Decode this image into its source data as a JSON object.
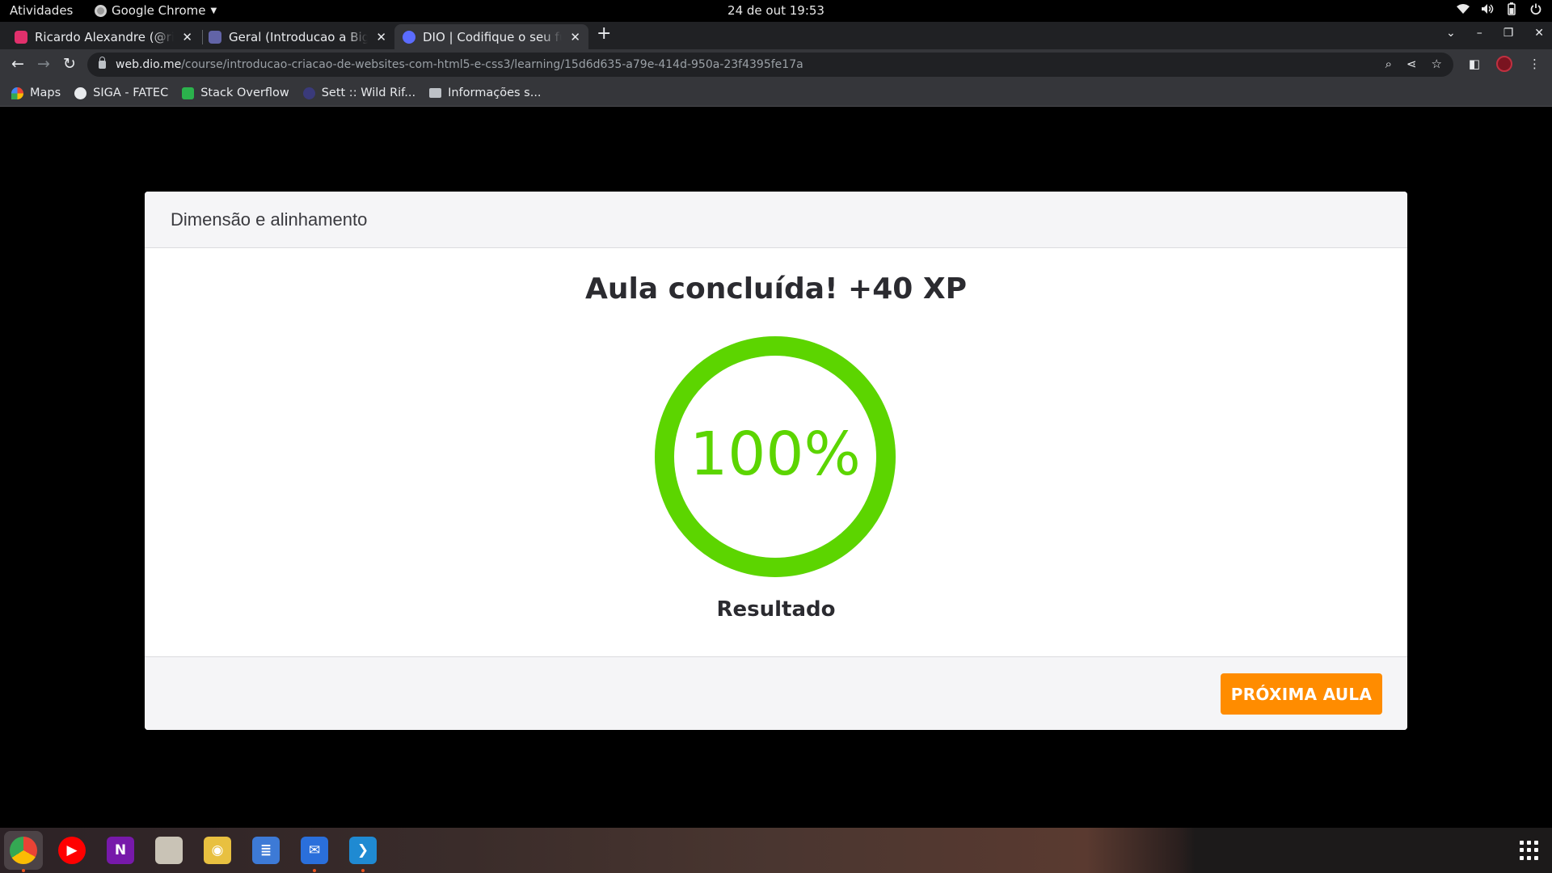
{
  "topbar": {
    "activities": "Atividades",
    "app_menu": "Google Chrome",
    "clock": "24 de out  19:53"
  },
  "tabs": [
    {
      "title": "Ricardo Alexandre (@ricardo",
      "favicon_color": "#e1306c",
      "active": false
    },
    {
      "title": "Geral (Introducao a Big Data",
      "favicon_color": "#6264a7",
      "active": false
    },
    {
      "title": "DIO | Codifique o seu futuro",
      "favicon_color": "#5b6cff",
      "active": true
    }
  ],
  "toolbar": {
    "url_host": "web.dio.me",
    "url_path": "/course/introducao-criacao-de-websites-com-html5-e-css3/learning/15d6d635-a79e-414d-950a-23f4395fe17a"
  },
  "bookmarks": [
    {
      "label": "Maps",
      "icon": "maps-icon",
      "color": "#34a853"
    },
    {
      "label": "SIGA - FATEC",
      "icon": "globe-icon",
      "color": "#e8eaed"
    },
    {
      "label": "Stack Overflow",
      "icon": "stack-overflow-icon",
      "color": "#2bb24c"
    },
    {
      "label": "Sett :: Wild Rif...",
      "icon": "wildrift-icon",
      "color": "#4a4a9a"
    },
    {
      "label": "Informações s...",
      "icon": "folder-icon",
      "color": "#bdc1c6"
    }
  ],
  "lesson": {
    "section_title": "Dimensão e alinhamento",
    "headline": "Aula concluída! +40 XP",
    "progress_percent": 100,
    "progress_text": "100%",
    "result_label": "Resultado",
    "next_button": "PRÓXIMA AULA",
    "accent_color": "#5cd500",
    "button_color": "#ff8c00"
  },
  "dock": [
    {
      "name": "chrome-icon",
      "color": "#ea4335",
      "glyph": "",
      "focused": true
    },
    {
      "name": "youtube-music-icon",
      "color": "#ff0000",
      "glyph": "▶"
    },
    {
      "name": "onenote-icon",
      "color": "#7719aa",
      "glyph": "N"
    },
    {
      "name": "files-icon",
      "color": "#c9c3b6",
      "glyph": ""
    },
    {
      "name": "rhythmbox-icon",
      "color": "#e8c040",
      "glyph": "◉"
    },
    {
      "name": "text-editor-icon",
      "color": "#3d7ad6",
      "glyph": "≣"
    },
    {
      "name": "thunderbird-icon",
      "color": "#2a6fdb",
      "glyph": "✉"
    },
    {
      "name": "vscode-icon",
      "color": "#1f8ad2",
      "glyph": "❯"
    }
  ]
}
